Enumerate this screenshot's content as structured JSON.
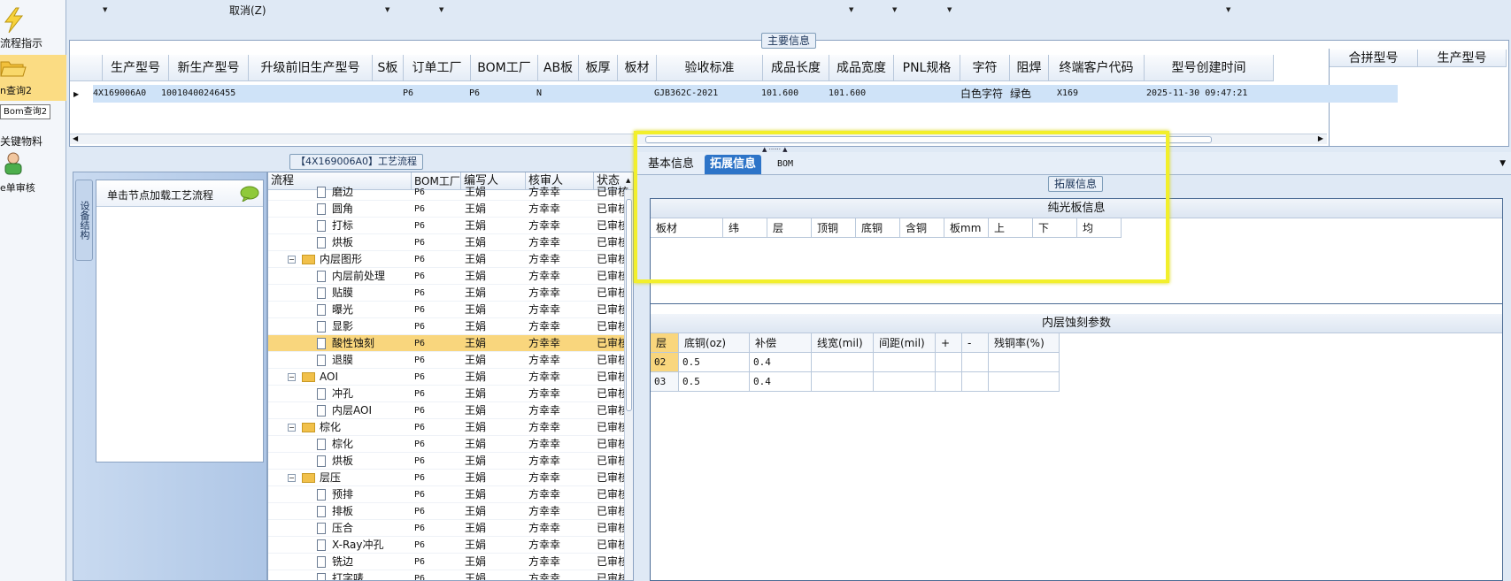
{
  "nav": {
    "items": [
      {
        "label": "流程指示",
        "icon": "lightning-icon"
      },
      {
        "label": "n查询2",
        "icon": "folder-open-icon"
      },
      {
        "label": "关键物料",
        "icon": "box-icon"
      },
      {
        "label": "e单审核",
        "icon": "user-icon"
      }
    ],
    "tooltip": "Bom查询2"
  },
  "toolbar": {
    "cancel_label": "取消(Z)"
  },
  "main_info": {
    "title": "主要信息",
    "columns": [
      "生产型号",
      "新生产型号",
      "升级前旧生产型号",
      "S板",
      "订单工厂",
      "BOM工厂",
      "AB板",
      "板厚",
      "板材",
      "验收标准",
      "成品长度",
      "成品宽度",
      "PNL规格",
      "字符",
      "阻焊",
      "终端客户代码",
      "型号创建时间"
    ],
    "row": {
      "prod_model": "4X169006A0",
      "new_model": "10010400246455",
      "old_model": "",
      "s_board": "",
      "order_factory": "P6",
      "bom_factory": "P6",
      "ab_board": "N",
      "thickness": "",
      "material": "",
      "standard": "GJB362C-2021",
      "length": "101.600",
      "width": "101.600",
      "pnl": "",
      "char": "白色字符",
      "solder": "绿色",
      "customer": "X169",
      "created": "2025-11-30 09:47:21"
    },
    "merge_columns": [
      "合拼型号",
      "生产型号"
    ]
  },
  "process": {
    "title": "【4X169006A0】工艺流程",
    "side_tab": "设备结构",
    "side_hint": "单击节点加载工艺流程",
    "columns": [
      "流程",
      "BOM工厂",
      "编写人",
      "核审人",
      "状态"
    ],
    "rows": [
      {
        "name": "磨边",
        "factory": "P6",
        "writer": "王娟",
        "reviewer": "方幸幸",
        "status": "已审核"
      },
      {
        "name": "圆角",
        "factory": "P6",
        "writer": "王娟",
        "reviewer": "方幸幸",
        "status": "已审核"
      },
      {
        "name": "打标",
        "factory": "P6",
        "writer": "王娟",
        "reviewer": "方幸幸",
        "status": "已审核"
      },
      {
        "name": "烘板",
        "factory": "P6",
        "writer": "王娟",
        "reviewer": "方幸幸",
        "status": "已审核"
      },
      {
        "name": "内层图形",
        "factory": "P6",
        "writer": "王娟",
        "reviewer": "方幸幸",
        "status": "已审核"
      },
      {
        "name": "内层前处理",
        "factory": "P6",
        "writer": "王娟",
        "reviewer": "方幸幸",
        "status": "已审核"
      },
      {
        "name": "贴膜",
        "factory": "P6",
        "writer": "王娟",
        "reviewer": "方幸幸",
        "status": "已审核"
      },
      {
        "name": "曝光",
        "factory": "P6",
        "writer": "王娟",
        "reviewer": "方幸幸",
        "status": "已审核"
      },
      {
        "name": "显影",
        "factory": "P6",
        "writer": "王娟",
        "reviewer": "方幸幸",
        "status": "已审核"
      },
      {
        "name": "酸性蚀刻",
        "factory": "P6",
        "writer": "王娟",
        "reviewer": "方幸幸",
        "status": "已审核"
      },
      {
        "name": "退膜",
        "factory": "P6",
        "writer": "王娟",
        "reviewer": "方幸幸",
        "status": "已审核"
      },
      {
        "name": "AOI",
        "factory": "P6",
        "writer": "王娟",
        "reviewer": "方幸幸",
        "status": "已审核"
      },
      {
        "name": "冲孔",
        "factory": "P6",
        "writer": "王娟",
        "reviewer": "方幸幸",
        "status": "已审核"
      },
      {
        "name": "内层AOI",
        "factory": "P6",
        "writer": "王娟",
        "reviewer": "方幸幸",
        "status": "已审核"
      },
      {
        "name": "棕化",
        "factory": "P6",
        "writer": "王娟",
        "reviewer": "方幸幸",
        "status": "已审核"
      },
      {
        "name": "棕化",
        "factory": "P6",
        "writer": "王娟",
        "reviewer": "方幸幸",
        "status": "已审核"
      },
      {
        "name": "烘板",
        "factory": "P6",
        "writer": "王娟",
        "reviewer": "方幸幸",
        "status": "已审核"
      },
      {
        "name": "层压",
        "factory": "P6",
        "writer": "王娟",
        "reviewer": "方幸幸",
        "status": "已审核"
      },
      {
        "name": "预排",
        "factory": "P6",
        "writer": "王娟",
        "reviewer": "方幸幸",
        "status": "已审核"
      },
      {
        "name": "排板",
        "factory": "P6",
        "writer": "王娟",
        "reviewer": "方幸幸",
        "status": "已审核"
      },
      {
        "name": "压合",
        "factory": "P6",
        "writer": "王娟",
        "reviewer": "方幸幸",
        "status": "已审核"
      },
      {
        "name": "X-Ray冲孔",
        "factory": "P6",
        "writer": "王娟",
        "reviewer": "方幸幸",
        "status": "已审核"
      },
      {
        "name": "铣边",
        "factory": "P6",
        "writer": "王娟",
        "reviewer": "方幸幸",
        "status": "已审核"
      },
      {
        "name": "打字唛",
        "factory": "P6",
        "writer": "王娟",
        "reviewer": "方幸幸",
        "status": "已审核"
      }
    ]
  },
  "right": {
    "tabs": [
      "基本信息",
      "拓展信息",
      "BOM"
    ],
    "group_title": "拓展信息",
    "smooth_board": {
      "title": "纯光板信息",
      "columns": [
        "板材",
        "纬",
        "层",
        "顶铜",
        "底铜",
        "含铜",
        "板mm",
        "上",
        "下",
        "均"
      ]
    },
    "etch": {
      "title": "内层蚀刻参数",
      "columns": [
        "层",
        "底铜(oz)",
        "补偿",
        "线宽(mil)",
        "间距(mil)",
        "+",
        "-",
        "残铜率(%)"
      ],
      "rows": [
        [
          "02",
          "0.5",
          "0.4",
          "",
          "",
          "",
          "",
          ""
        ],
        [
          "03",
          "0.5",
          "0.4",
          "",
          "",
          "",
          "",
          ""
        ]
      ]
    }
  }
}
